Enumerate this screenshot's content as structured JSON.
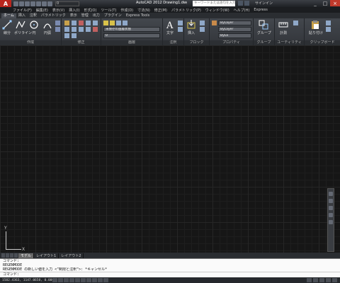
{
  "titlebar": {
    "app_button_label": "A",
    "workspace": "0",
    "window_title": "AutoCAD 2012  Drawing1.dwg",
    "search_placeholder": "キーワードまたは語句を入力",
    "signin": "サインイン",
    "min": "_",
    "max": "□",
    "close": "×"
  },
  "menubar": {
    "items": [
      "ファイル(F)",
      "編集(E)",
      "表示(V)",
      "挿入(I)",
      "形式(O)",
      "ツール(T)",
      "作成(D)",
      "寸法(N)",
      "修正(M)",
      "パラメトリック(P)",
      "ウィンドウ(W)",
      "ヘルプ(H)",
      "Express"
    ]
  },
  "ribbon_tabs": {
    "items": [
      "ホーム",
      "挿入",
      "注釈",
      "パラメトリック",
      "表示",
      "管理",
      "出力",
      "プラグイン",
      "Express Tools"
    ],
    "active_index": 0
  },
  "ribbon": {
    "draw": {
      "title": "作成",
      "line": "線分",
      "polyline": "ポリライン",
      "circle": "円",
      "arc": "円弧"
    },
    "modify": {
      "title": "修正"
    },
    "layers": {
      "title": "画層",
      "layer_state": "未保存の画層状態",
      "current_layer": "0"
    },
    "annotation": {
      "title": "注釈",
      "text": "文字"
    },
    "block": {
      "title": "ブロック",
      "insert": "挿入"
    },
    "properties": {
      "title": "プロパティ",
      "color": "ByLayer",
      "linetype": "ByLayer",
      "lineweight": "ByLa"
    },
    "groups": {
      "title": "グループ",
      "group": "グループ"
    },
    "utilities": {
      "title": "ユーティリティ",
      "measure": "計測"
    },
    "clipboard": {
      "title": "クリップボード",
      "paste": "貼り付け"
    }
  },
  "drawing": {
    "ucs_x": "X",
    "ucs_y": "Y"
  },
  "layout_tabs": {
    "items": [
      "モデル",
      "レイアウト1",
      "レイアウト2"
    ],
    "active_index": 0
  },
  "command_line": {
    "lines": [
      "コマンド:",
      "REGENMODE",
      "REGENMODE の新しい値を入力 <\"制限と注釈\">: *キャンセル*"
    ],
    "prompt": "コマンド:"
  },
  "statusbar": {
    "coordinates": "1582.4363, 1147.0658, 0.0000"
  },
  "colors": {
    "app_red": "#b8261e",
    "ribbon_bg": "#3c4046",
    "drawing_bg": "#161616"
  }
}
